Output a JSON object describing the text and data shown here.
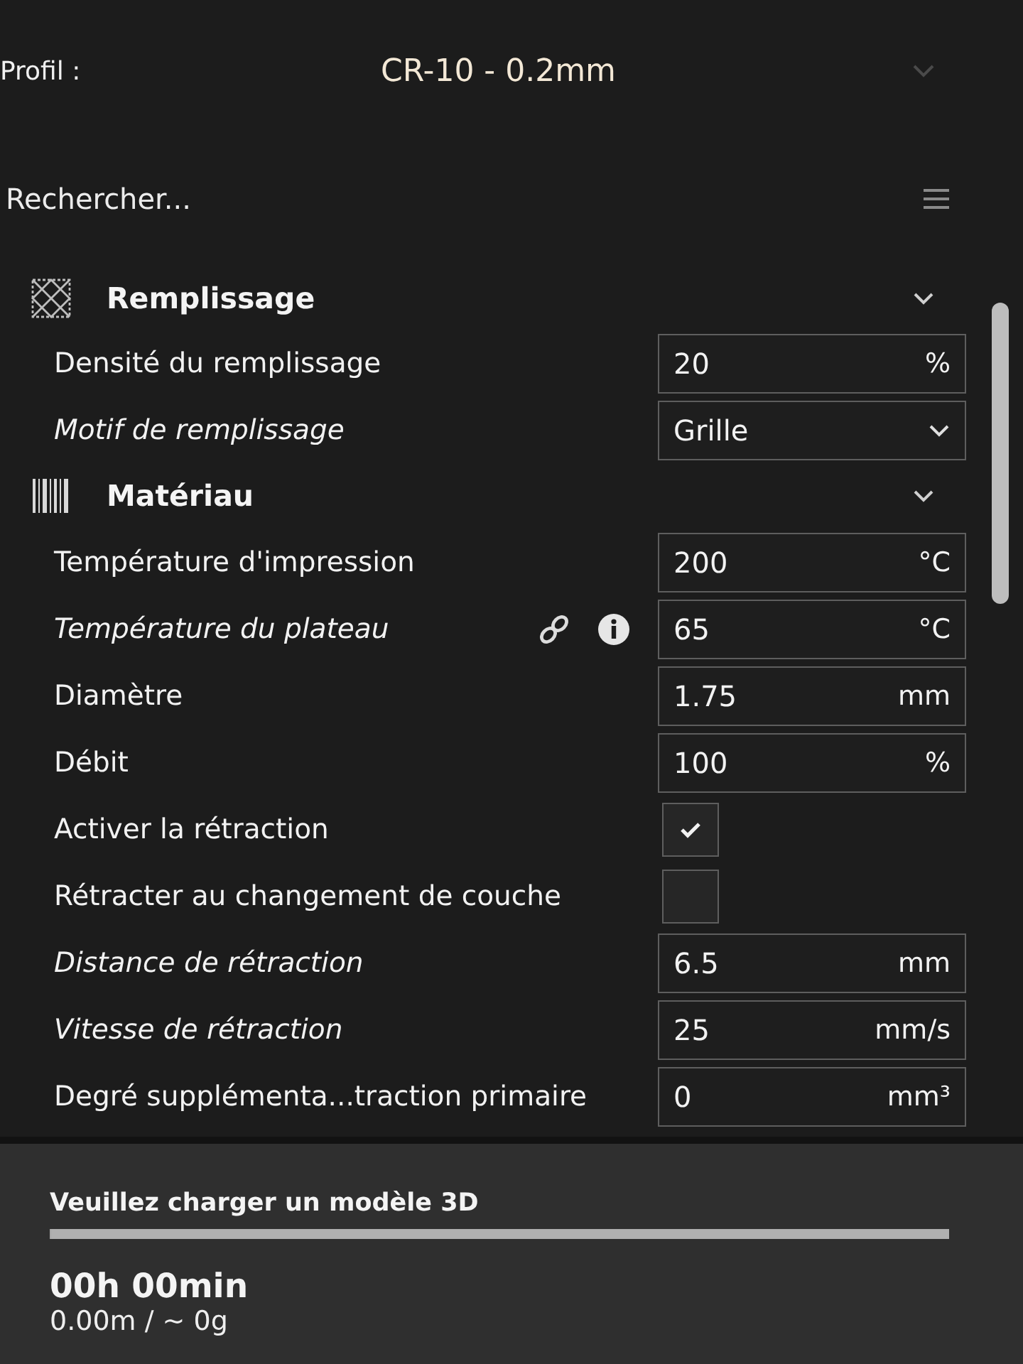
{
  "profile": {
    "label": "Profil :",
    "value": "CR-10 - 0.2mm"
  },
  "search": {
    "placeholder": "Rechercher..."
  },
  "sections": [
    {
      "title": "Remplissage",
      "kind": "infill",
      "expanded": true,
      "settings": [
        {
          "label": "Densité du remplissage",
          "kind": "number",
          "italic": false,
          "linked": false,
          "info": false,
          "value": "20",
          "unit": "%"
        },
        {
          "label": "Motif de remplissage",
          "kind": "dropdown",
          "italic": true,
          "linked": false,
          "info": false,
          "value": "Grille"
        }
      ]
    },
    {
      "title": "Matériau",
      "kind": "material",
      "expanded": true,
      "settings": [
        {
          "label": "Température d'impression",
          "kind": "number",
          "italic": false,
          "linked": false,
          "info": false,
          "value": "200",
          "unit": "°C"
        },
        {
          "label": "Température du plateau",
          "kind": "number",
          "italic": true,
          "linked": true,
          "info": true,
          "value": "65",
          "unit": "°C"
        },
        {
          "label": "Diamètre",
          "kind": "number",
          "italic": false,
          "linked": false,
          "info": false,
          "value": "1.75",
          "unit": "mm"
        },
        {
          "label": "Débit",
          "kind": "number",
          "italic": false,
          "linked": false,
          "info": false,
          "value": "100",
          "unit": "%"
        },
        {
          "label": "Activer la rétraction",
          "kind": "checkbox",
          "italic": false,
          "linked": false,
          "info": false,
          "checked": true
        },
        {
          "label": "Rétracter au changement de couche",
          "kind": "checkbox",
          "italic": false,
          "linked": false,
          "info": false,
          "checked": false
        },
        {
          "label": "Distance de rétraction",
          "kind": "number",
          "italic": true,
          "linked": false,
          "info": false,
          "value": "6.5",
          "unit": "mm"
        },
        {
          "label": "Vitesse de rétraction",
          "kind": "number",
          "italic": true,
          "linked": false,
          "info": false,
          "value": "25",
          "unit": "mm/s"
        },
        {
          "label": "Degré supplémenta...traction primaire",
          "kind": "number",
          "italic": false,
          "linked": false,
          "info": false,
          "value": "0",
          "unit": "mm³"
        }
      ]
    }
  ],
  "status": {
    "message": "Veuillez charger un modèle 3D",
    "level": 0,
    "time": "00h 00min",
    "material": "0.00m / ~ 0g"
  }
}
